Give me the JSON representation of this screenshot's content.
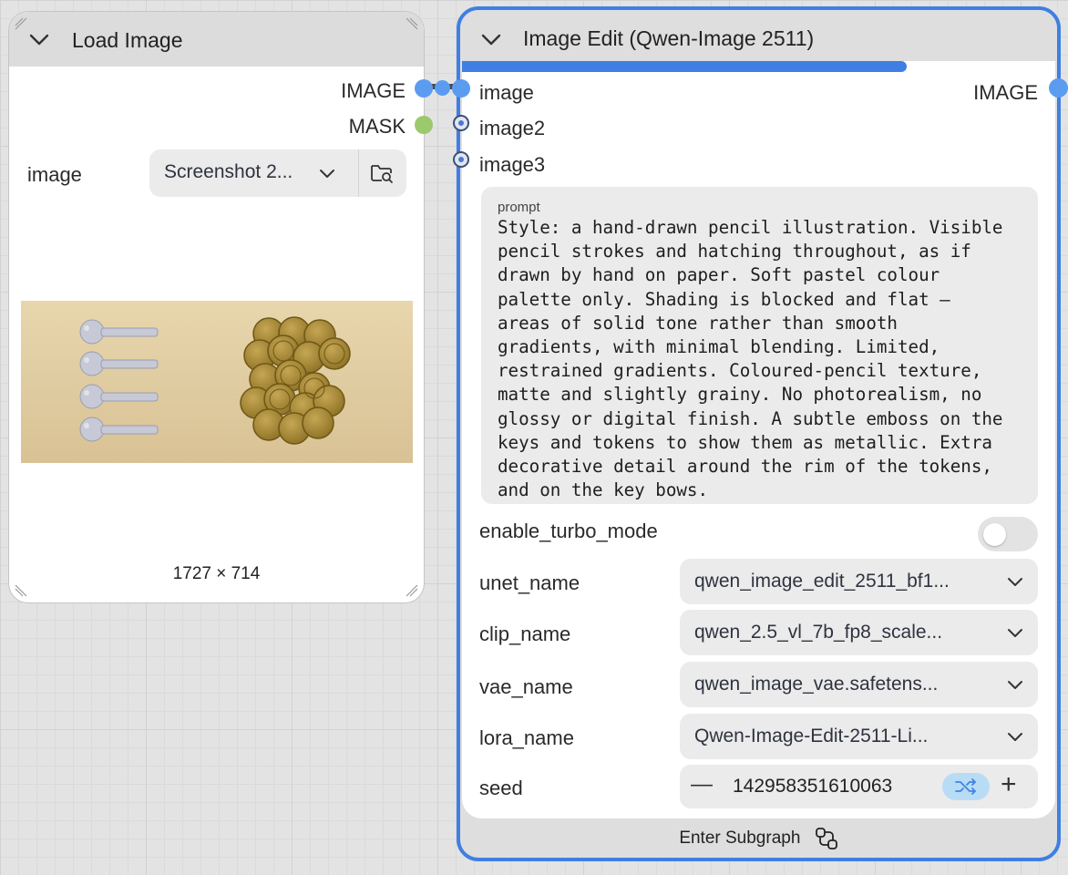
{
  "load_image_node": {
    "title": "Load Image",
    "outputs": {
      "image": "IMAGE",
      "mask": "MASK"
    },
    "widget": {
      "label": "image",
      "value": "Screenshot 2..."
    },
    "preview": {
      "dimensions": "1727 × 714"
    }
  },
  "image_edit_node": {
    "title": "Image Edit (Qwen-Image 2511)",
    "progress": 0.75,
    "inputs": [
      "image",
      "image2",
      "image3"
    ],
    "output": "IMAGE",
    "prompt": {
      "label": "prompt",
      "text": "Style: a hand-drawn pencil illustration. Visible\npencil strokes and hatching throughout, as if\ndrawn by hand on paper. Soft pastel colour\npalette only. Shading is blocked and flat —\nareas of solid tone rather than smooth\ngradients, with minimal blending. Limited,\nrestrained gradients. Coloured-pencil texture,\nmatte and slightly grainy. No photorealism, no\nglossy or digital finish. A subtle emboss on the\nkeys and tokens to show them as metallic. Extra\ndecorative detail around the rim of the tokens,\nand on the key bows."
    },
    "toggle": {
      "label": "enable_turbo_mode",
      "on": false
    },
    "widgets": {
      "unet_name": {
        "label": "unet_name",
        "value": "qwen_image_edit_2511_bf1..."
      },
      "clip_name": {
        "label": "clip_name",
        "value": "qwen_2.5_vl_7b_fp8_scale..."
      },
      "vae_name": {
        "label": "vae_name",
        "value": "qwen_image_vae.safetens..."
      },
      "lora_name": {
        "label": "lora_name",
        "value": "Qwen-Image-Edit-2511-Li..."
      }
    },
    "seed": {
      "label": "seed",
      "value": "142958351610063",
      "decrement": "—",
      "increment": "+"
    },
    "footer": {
      "label": "Enter Subgraph"
    }
  },
  "colors": {
    "selection_border": "#3f7fe3",
    "image_socket": "#5b9cf0",
    "mask_socket": "#9cc96b",
    "node_header": "#dcdcdc",
    "widget_bg": "#ebebeb"
  },
  "icons": [
    "chevron-down-icon",
    "folder-search-icon",
    "shuffle-icon",
    "subgraph-icon"
  ]
}
